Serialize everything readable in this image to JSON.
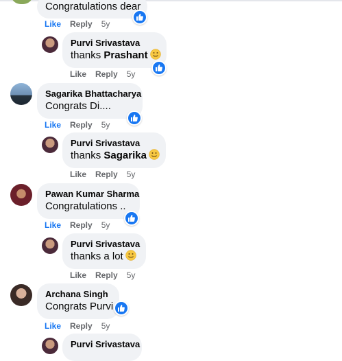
{
  "like_label": "Like",
  "reply_label": "Reply",
  "time_label": "5y",
  "comments": [
    {
      "name": "",
      "text": "Congratulations dear"
    },
    {
      "name": "Purvi Srivastava",
      "text_prefix": "thanks ",
      "mention": "Prashant"
    },
    {
      "name": "Sagarika Bhattacharya",
      "text": "Congrats Di...."
    },
    {
      "name": "Purvi Srivastava",
      "text_prefix": "thanks ",
      "mention": "Sagarika"
    },
    {
      "name": "Pawan Kumar Sharma",
      "text": "Congratulations .."
    },
    {
      "name": "Purvi Srivastava",
      "text": "thanks a lot"
    },
    {
      "name": "Archana Singh",
      "text": "Congrats Purvi"
    },
    {
      "name": "Purvi Srivastava",
      "text": ""
    }
  ],
  "colors": {
    "like_blue": "#1877f2",
    "bubble_bg": "#f0f2f5",
    "meta_gray": "#65676b"
  },
  "icons": {
    "reaction": "thumbs-up-icon",
    "emoji": "smiley-emoji-icon"
  }
}
